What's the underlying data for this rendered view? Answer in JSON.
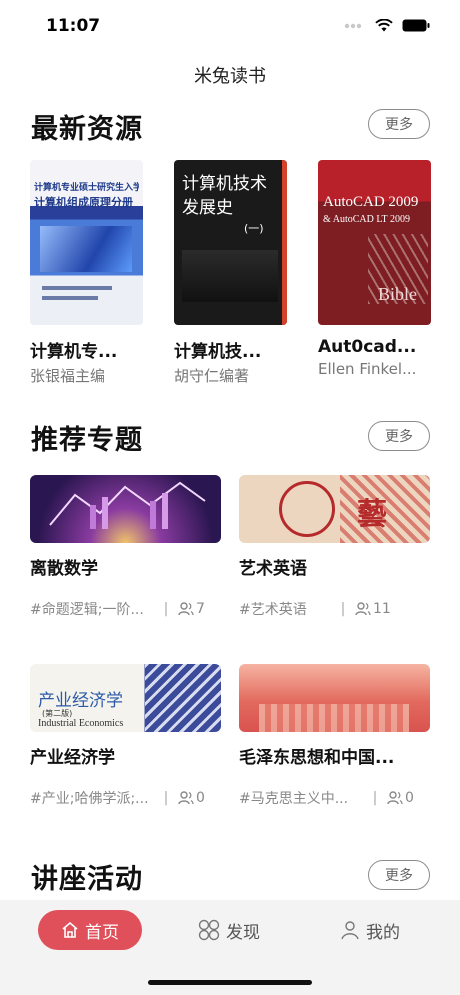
{
  "status": {
    "time": "11:07"
  },
  "nav": {
    "title": "米兔读书"
  },
  "sections": {
    "latest": {
      "title": "最新资源",
      "more": "更多"
    },
    "topics": {
      "title": "推荐专题",
      "more": "更多"
    },
    "lectures": {
      "title": "讲座活动",
      "more": "更多"
    }
  },
  "books": [
    {
      "title": "计算机专...",
      "author": "张银福主编",
      "cover_text": "计算机专业硕士研究生入学考试",
      "cover_main": "计算机组成原理分册"
    },
    {
      "title": "计算机技...",
      "author": "胡守仁编著",
      "cover_text": "计算机技术发展史",
      "cover_main": "(一)"
    },
    {
      "title": "Aut0cad...",
      "author": "Ellen Finkel...",
      "cover_text": "AutoCAD 2009",
      "cover_main": "& AutoCAD LT 2009",
      "cover_sub": "Bible"
    }
  ],
  "topics": [
    {
      "title": "离散数学",
      "tags": "#命题逻辑;一阶...",
      "count": "7"
    },
    {
      "title": "艺术英语",
      "tags": "#艺术英语",
      "count": "11",
      "image_glyph": "藝"
    },
    {
      "title": "产业经济学",
      "tags": "#产业;哈佛学派;...",
      "count": "0",
      "image_title": "产业经济学",
      "image_edition": "(第二版)",
      "image_en": "Industrial Economics"
    },
    {
      "title": "毛泽东思想和中国...",
      "tags": "#马克思主义中...",
      "count": "0"
    }
  ],
  "tabbar": {
    "home": "首页",
    "discover": "发现",
    "mine": "我的",
    "accent": "#e0505b"
  }
}
